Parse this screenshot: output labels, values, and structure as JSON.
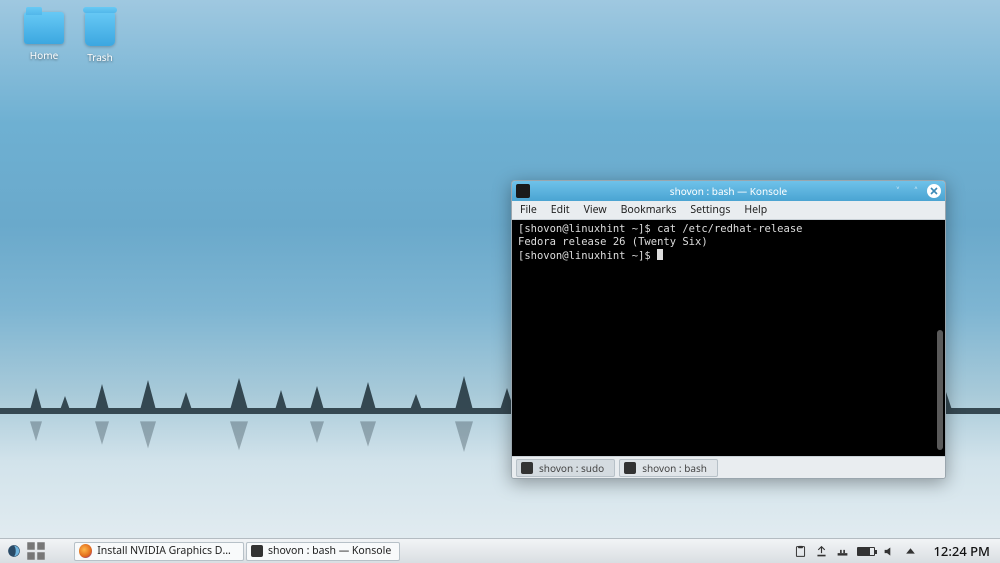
{
  "desktop": {
    "icons": [
      {
        "label": "Home"
      },
      {
        "label": "Trash"
      }
    ]
  },
  "window": {
    "title": "shovon : bash — Konsole",
    "menubar": [
      "File",
      "Edit",
      "View",
      "Bookmarks",
      "Settings",
      "Help"
    ],
    "terminal": {
      "line1": "[shovon@linuxhint ~]$ cat /etc/redhat-release",
      "line2": "Fedora release 26 (Twenty Six)",
      "line3": "[shovon@linuxhint ~]$ "
    },
    "tabs": [
      {
        "label": "shovon : sudo"
      },
      {
        "label": "shovon : bash"
      }
    ]
  },
  "taskbar": {
    "tasks": [
      {
        "label": "Install NVIDIA Graphics Driv..."
      },
      {
        "label": "shovon : bash — Konsole"
      }
    ],
    "clock": "12:24 PM"
  }
}
